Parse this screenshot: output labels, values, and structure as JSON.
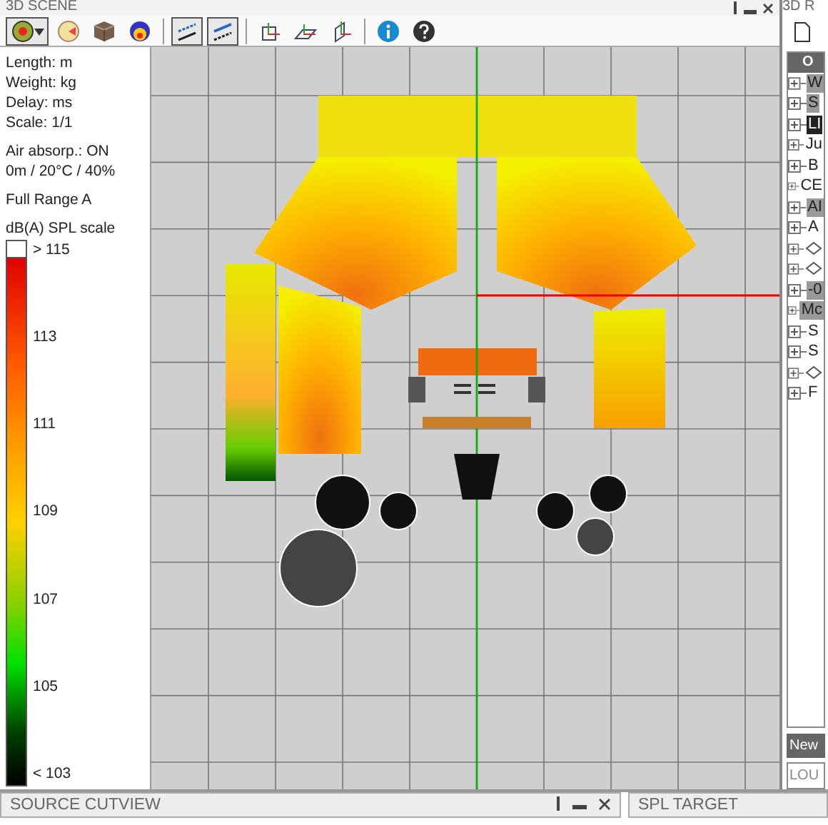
{
  "window": {
    "title": "3D SCENE"
  },
  "toolbar": [
    {
      "kind": "source",
      "selected": true
    },
    {
      "kind": "speaker",
      "selected": false
    },
    {
      "kind": "box",
      "selected": false
    },
    {
      "kind": "layers",
      "selected": false
    },
    {
      "kind": "separator"
    },
    {
      "kind": "lines-a",
      "selected": true
    },
    {
      "kind": "lines-b",
      "selected": true
    },
    {
      "kind": "separator"
    },
    {
      "kind": "frame-axis",
      "selected": false
    },
    {
      "kind": "plane-axis",
      "selected": false
    },
    {
      "kind": "vertical-axis",
      "selected": false
    },
    {
      "kind": "separator"
    },
    {
      "kind": "info",
      "selected": false
    },
    {
      "kind": "help",
      "selected": false
    }
  ],
  "info": {
    "units": [
      "Length: m",
      "Weight: kg",
      "Delay: ms",
      "Scale: 1/1"
    ],
    "air": [
      "Air absorp.: ON",
      "0m / 20°C / 40%"
    ],
    "source": "Full Range A"
  },
  "scale": {
    "title": "dB(A) SPL scale",
    "labels": [
      "> 115",
      "113",
      "111",
      "109",
      "107",
      "105",
      "< 103"
    ]
  },
  "right_panel": {
    "title": "3D R",
    "header": "O",
    "tree": [
      {
        "kind": "text",
        "label": "W",
        "selected": false,
        "highlighted": true
      },
      {
        "kind": "text",
        "label": "S",
        "selected": false,
        "highlighted": true
      },
      {
        "kind": "text",
        "label": "LI",
        "selected": true,
        "highlighted": false
      },
      {
        "kind": "text",
        "label": "Ju",
        "selected": false,
        "highlighted": false
      },
      {
        "kind": "text",
        "label": "B",
        "selected": false,
        "highlighted": false
      },
      {
        "kind": "text",
        "label": "CE",
        "selected": false,
        "highlighted": false
      },
      {
        "kind": "text",
        "label": "AI",
        "selected": false,
        "highlighted": true
      },
      {
        "kind": "text",
        "label": "A",
        "selected": false,
        "highlighted": false
      },
      {
        "kind": "icon",
        "selected": false,
        "highlighted": false
      },
      {
        "kind": "icon",
        "selected": false,
        "highlighted": false
      },
      {
        "kind": "text",
        "label": "-0",
        "selected": false,
        "highlighted": true
      },
      {
        "kind": "text",
        "label": "Mc",
        "selected": false,
        "highlighted": true
      },
      {
        "kind": "text",
        "label": "S",
        "selected": false,
        "highlighted": false
      },
      {
        "kind": "text",
        "label": "S",
        "selected": false,
        "highlighted": false
      },
      {
        "kind": "icon",
        "selected": false,
        "highlighted": false
      },
      {
        "kind": "text",
        "label": "F",
        "selected": false,
        "highlighted": false
      }
    ],
    "new_button": "New",
    "tab": "LOU"
  },
  "bottom_panels": [
    {
      "title": "SOURCE CUTVIEW",
      "controls": true
    },
    {
      "title": "SPL TARGET",
      "controls": false
    }
  ]
}
